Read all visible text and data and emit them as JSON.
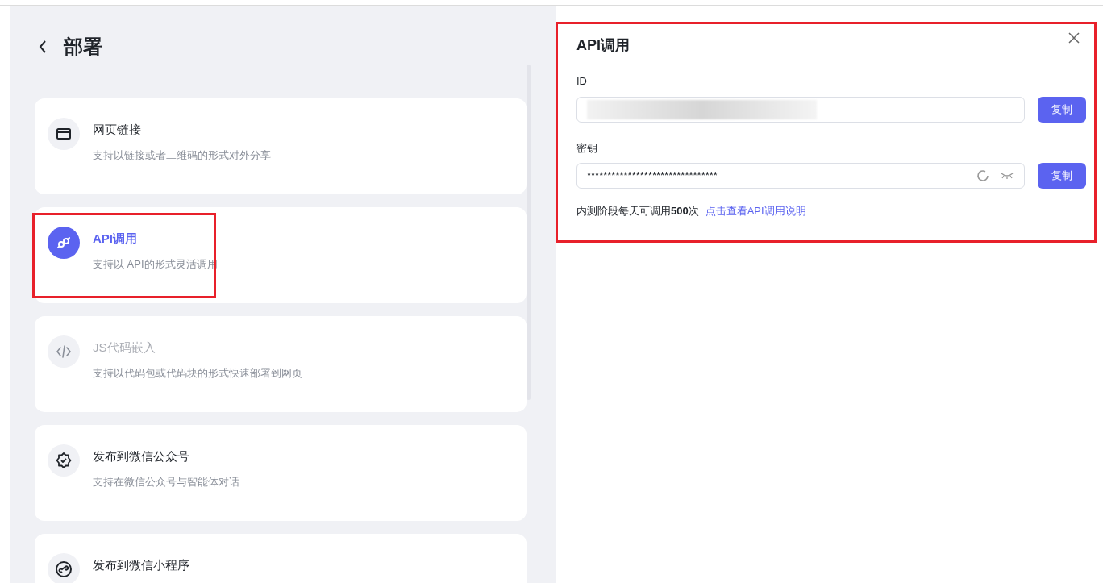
{
  "header": {
    "title": "部署"
  },
  "options": [
    {
      "kind": "browser",
      "title": "网页链接",
      "description": "支持以链接或者二维码的形式对外分享",
      "selected": false,
      "disabled": false
    },
    {
      "kind": "plug",
      "title": "API调用",
      "description": "支持以 API的形式灵活调用",
      "selected": true,
      "disabled": false
    },
    {
      "kind": "code",
      "title": "JS代码嵌入",
      "description": "支持以代码包或代码块的形式快速部署到网页",
      "selected": false,
      "disabled": true
    },
    {
      "kind": "badge",
      "title": "发布到微信公众号",
      "description": "支持在微信公众号与智能体对话",
      "selected": false,
      "disabled": false
    },
    {
      "kind": "link",
      "title": "发布到微信小程序",
      "selected": false,
      "disabled": false
    }
  ],
  "panel": {
    "title": "API调用",
    "fields": [
      {
        "label": "ID",
        "value_redacted": true,
        "button": "复制"
      },
      {
        "label": "密钥",
        "value": "********************************",
        "button": "复制",
        "refreshable": true,
        "masked": true
      }
    ],
    "note": {
      "text": "内测阶段每天可调用**500**次",
      "link": "点击查看API调用说明"
    }
  }
}
